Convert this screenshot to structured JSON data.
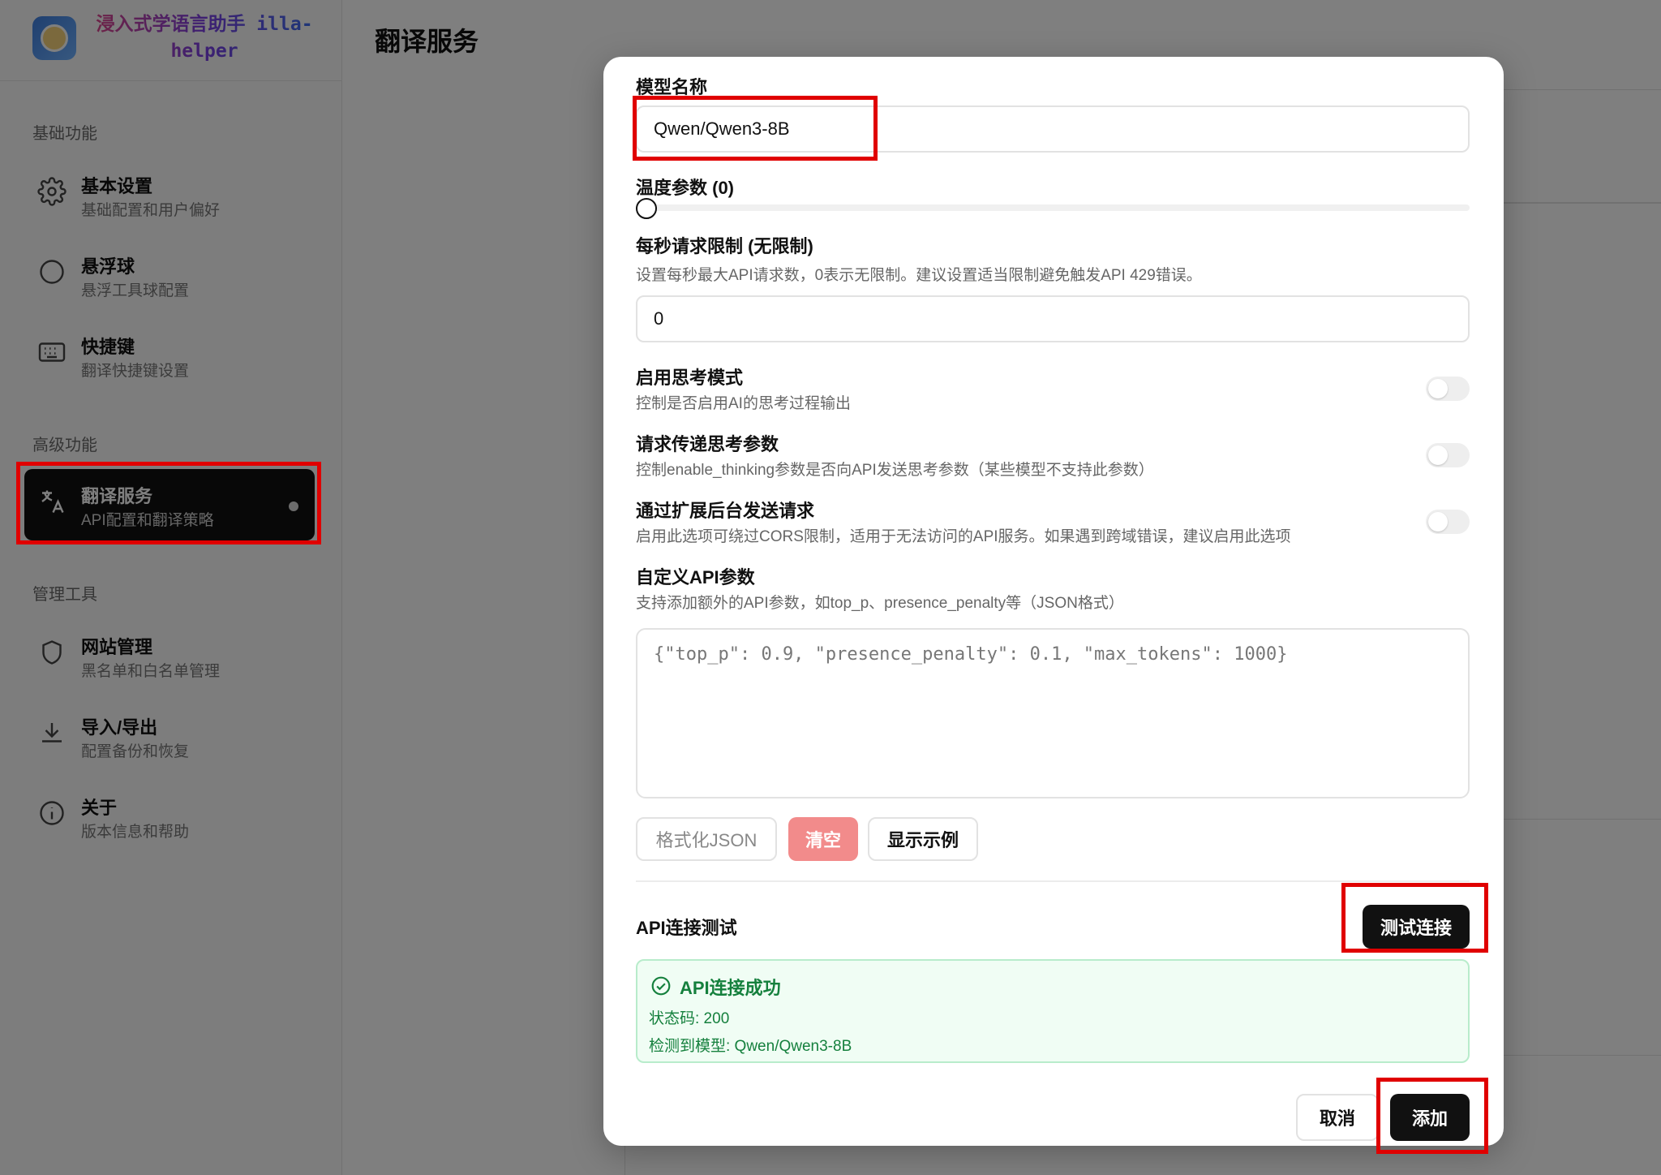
{
  "app": {
    "name": "浸入式学语言助手 illa-helper",
    "page_title": "翻译服务"
  },
  "sidebar": {
    "sections": [
      {
        "label": "基础功能",
        "items": [
          {
            "title": "基本设置",
            "subtitle": "基础配置和用户偏好",
            "icon": "gear-icon"
          },
          {
            "title": "悬浮球",
            "subtitle": "悬浮工具球配置",
            "icon": "circle-icon"
          },
          {
            "title": "快捷键",
            "subtitle": "翻译快捷键设置",
            "icon": "keyboard-icon"
          }
        ]
      },
      {
        "label": "高级功能",
        "items": [
          {
            "title": "翻译服务",
            "subtitle": "API配置和翻译策略",
            "icon": "translate-icon",
            "active": true
          }
        ]
      },
      {
        "label": "管理工具",
        "items": [
          {
            "title": "网站管理",
            "subtitle": "黑名单和白名单管理",
            "icon": "shield-icon"
          },
          {
            "title": "导入/导出",
            "subtitle": "配置备份和恢复",
            "icon": "download-icon"
          },
          {
            "title": "关于",
            "subtitle": "版本信息和帮助",
            "icon": "info-icon"
          }
        ]
      }
    ]
  },
  "modal": {
    "model_name": {
      "label": "模型名称",
      "value": "Qwen/Qwen3-8B"
    },
    "temperature": {
      "label": "温度参数 (0)",
      "value": 0
    },
    "rate_limit": {
      "label": "每秒请求限制 (无限制)",
      "help": "设置每秒最大API请求数，0表示无限制。建议设置适当限制避免触发API 429错误。",
      "value": "0"
    },
    "toggles": [
      {
        "label": "启用思考模式",
        "help": "控制是否启用AI的思考过程输出",
        "on": false
      },
      {
        "label": "请求传递思考参数",
        "help": "控制enable_thinking参数是否向API发送思考参数（某些模型不支持此参数）",
        "on": false
      },
      {
        "label": "通过扩展后台发送请求",
        "help": "启用此选项可绕过CORS限制，适用于无法访问的API服务。如果遇到跨域错误，建议启用此选项",
        "on": false
      }
    ],
    "custom_params": {
      "label": "自定义API参数",
      "help": "支持添加额外的API参数，如top_p、presence_penalty等（JSON格式）",
      "placeholder": "{\"top_p\": 0.9, \"presence_penalty\": 0.1, \"max_tokens\": 1000}"
    },
    "json_buttons": {
      "format": "格式化JSON",
      "clear": "清空",
      "example": "显示示例"
    },
    "api_test": {
      "label": "API连接测试",
      "button": "测试连接",
      "result_title": "API连接成功",
      "status_line": "状态码: 200",
      "model_line": "检测到模型: Qwen/Qwen3-8B"
    },
    "footer": {
      "cancel": "取消",
      "add": "添加"
    }
  },
  "colors": {
    "highlight": "#e00000",
    "success": "#15803d",
    "danger_button": "#f28b8b",
    "dark": "#111111"
  }
}
